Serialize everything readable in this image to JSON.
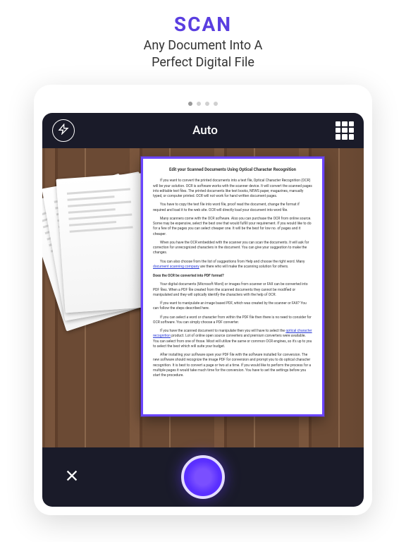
{
  "promo": {
    "title": "SCAN",
    "subtitle_line1": "Any Document Into A",
    "subtitle_line2": "Perfect Digital File"
  },
  "topbar": {
    "mode_label": "Auto"
  },
  "document": {
    "title": "Edit your Scanned Documents Using Optical Character Recognition",
    "p1": "If you want to convert the printed documents into a text file, Optical Character Recognition (OCR) will be your solution. OCR is software works with the scanner device. It will convert the scanned pages into editable text files. The printed documents like text books, NEWS paper, magazines, manually typed, or computer printed. OCR will not work for hand written document pages.",
    "p2": "You have to copy the text file into word file, proof read the document, change the format if required and load it to the web site. OCR will directly load your document into word file.",
    "p3": "Many scanners come with the OCR software. Also you can purchase the OCR from online source. Some may be expensive, select the best one that would fulfill your requirement. If you would like to do for a few of the pages you can select cheaper one. It will be the best for low no. of pages and it cheaper.",
    "p4": "When you have the OCR embedded with the scanner you can scan the documents. It will ask for correction for unrecognized characters in the document. You can give your suggestion to make the changes.",
    "p5a": "You can also choose from the list of suggestions from Help and choose the right word. Many ",
    "link1": "document scanning company",
    "p5b": " are there who will make the scanning solution for others.",
    "q1": "Does the OCR be converted into PDF format?",
    "p6": "Your digital documents (Microsoft Word) or images from scanner or FAX can be converted into PDF files. When a PDF file created from the scanned documents they cannot be modified or manipulated and they will optically identify the characters with the help of OCR.",
    "p7": "If you want to manipulate an image based PDF, which was created by the scanner or FAX? You can follow the steps described here.",
    "p8": "If you can select a word or character from within the PDF file then there is no need to consider for OCR software. You can simply choose a PDF converter.",
    "p9a": "If you have the scanned document to manipulate then you will have to select the ",
    "link2": "optical character recognition",
    "p9b": " product. Lot of online open source converters and premium converters were available. You can select from one of those. Most will utilize the same or common OCR engines, so it's up to you to select the best which will suite your budget.",
    "p10": "After installing your software open your PDF file with the software installed for conversion. The new software should recognize the image PDF for conversion and prompt you to do optical character recognition. It is best to convert a page or two at a time. If you would like to perform the process for a multiple pages it would take much time for the conversion. You have to set the settings before you start the procedure."
  }
}
